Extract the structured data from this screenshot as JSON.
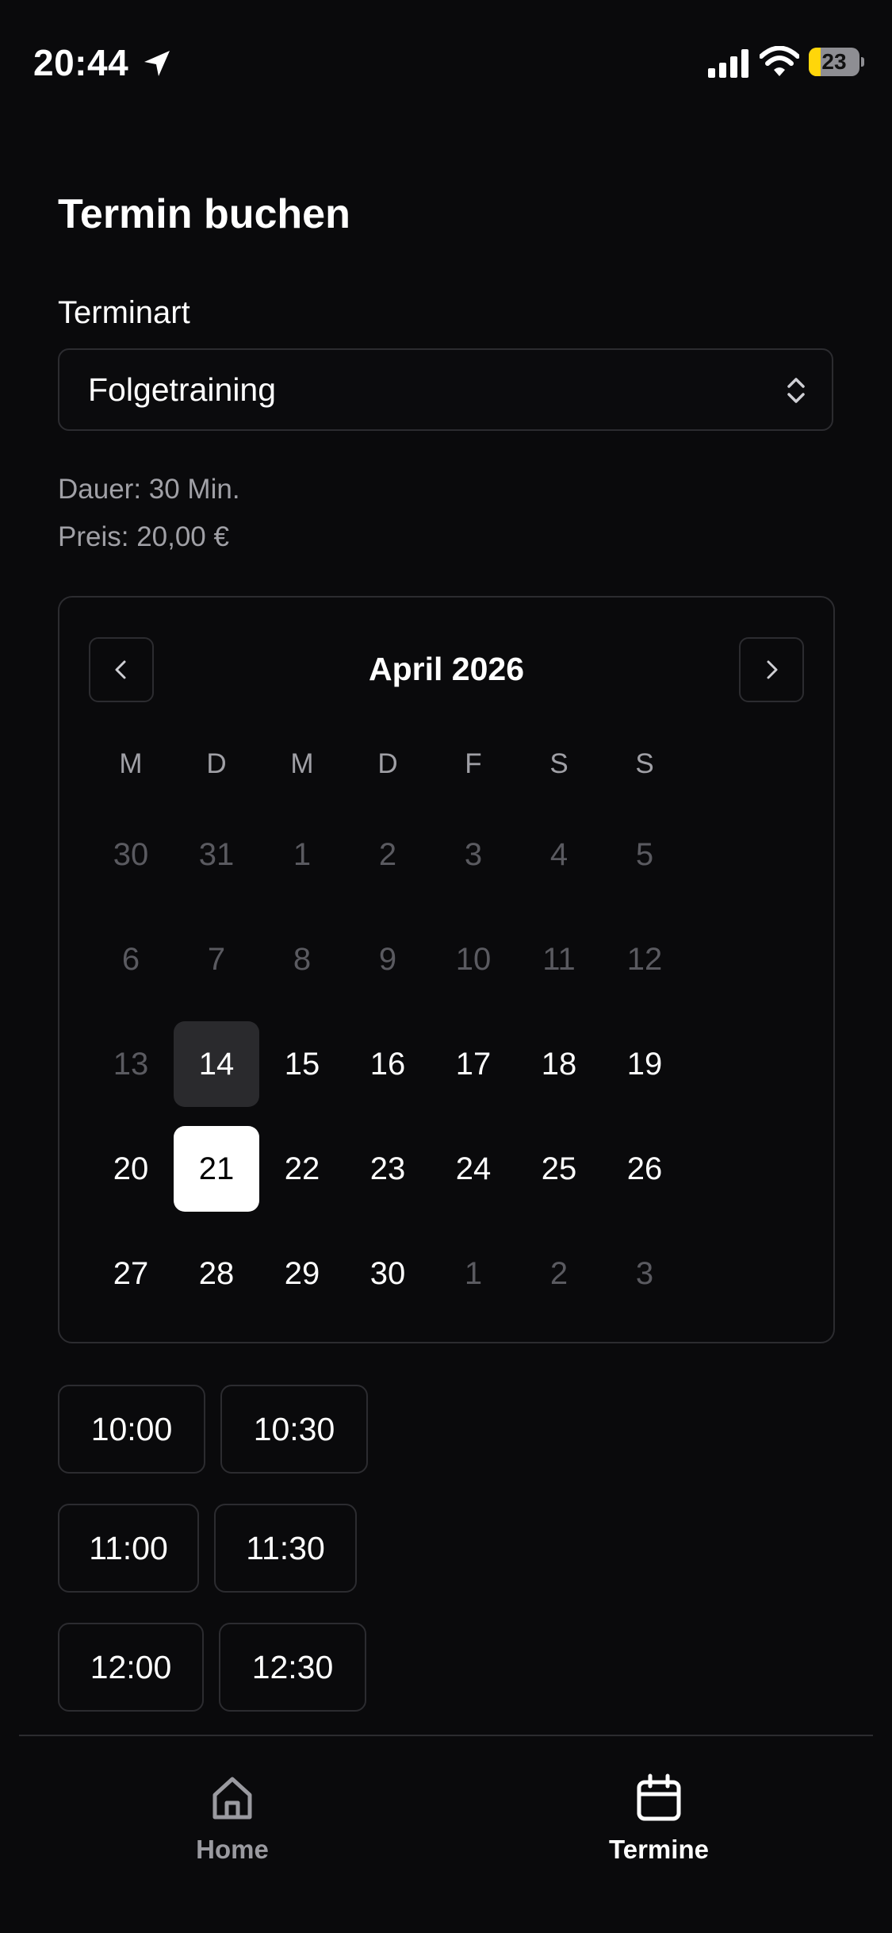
{
  "status_bar": {
    "time": "20:44",
    "battery": "23",
    "battery_level": 0.23
  },
  "page": {
    "title": "Termin buchen",
    "appointment_type_label": "Terminart",
    "appointment_type_value": "Folgetraining",
    "duration": "Dauer: 30 Min.",
    "price": "Preis: 20,00 €"
  },
  "calendar": {
    "month_label": "April 2026",
    "weekdays": [
      "M",
      "D",
      "M",
      "D",
      "F",
      "S",
      "S"
    ],
    "weeks": [
      [
        {
          "d": "30",
          "s": "outside"
        },
        {
          "d": "31",
          "s": "outside"
        },
        {
          "d": "1",
          "s": "outside"
        },
        {
          "d": "2",
          "s": "outside"
        },
        {
          "d": "3",
          "s": "outside"
        },
        {
          "d": "4",
          "s": "outside"
        },
        {
          "d": "5",
          "s": "outside"
        }
      ],
      [
        {
          "d": "6",
          "s": "outside"
        },
        {
          "d": "7",
          "s": "outside"
        },
        {
          "d": "8",
          "s": "outside"
        },
        {
          "d": "9",
          "s": "outside"
        },
        {
          "d": "10",
          "s": "outside"
        },
        {
          "d": "11",
          "s": "outside"
        },
        {
          "d": "12",
          "s": "outside"
        }
      ],
      [
        {
          "d": "13",
          "s": "outside"
        },
        {
          "d": "14",
          "s": "today"
        },
        {
          "d": "15",
          "s": "active"
        },
        {
          "d": "16",
          "s": "active"
        },
        {
          "d": "17",
          "s": "active"
        },
        {
          "d": "18",
          "s": "active"
        },
        {
          "d": "19",
          "s": "active"
        }
      ],
      [
        {
          "d": "20",
          "s": "active"
        },
        {
          "d": "21",
          "s": "selected"
        },
        {
          "d": "22",
          "s": "active"
        },
        {
          "d": "23",
          "s": "active"
        },
        {
          "d": "24",
          "s": "active"
        },
        {
          "d": "25",
          "s": "active"
        },
        {
          "d": "26",
          "s": "active"
        }
      ],
      [
        {
          "d": "27",
          "s": "active"
        },
        {
          "d": "28",
          "s": "active"
        },
        {
          "d": "29",
          "s": "active"
        },
        {
          "d": "30",
          "s": "active"
        },
        {
          "d": "1",
          "s": "outside"
        },
        {
          "d": "2",
          "s": "outside"
        },
        {
          "d": "3",
          "s": "outside"
        }
      ]
    ]
  },
  "time_slots": [
    "10:00",
    "10:30",
    "11:00",
    "11:30",
    "12:00",
    "12:30"
  ],
  "tab_bar": {
    "home_label": "Home",
    "appointments_label": "Termine"
  },
  "colors": {
    "background": "#0a0a0c",
    "border": "#2c2c30",
    "muted_text": "#a0a0a6",
    "selected_day_bg": "#ffffff",
    "today_bg": "#2a2a2d",
    "battery_yellow": "#ffd60a"
  }
}
